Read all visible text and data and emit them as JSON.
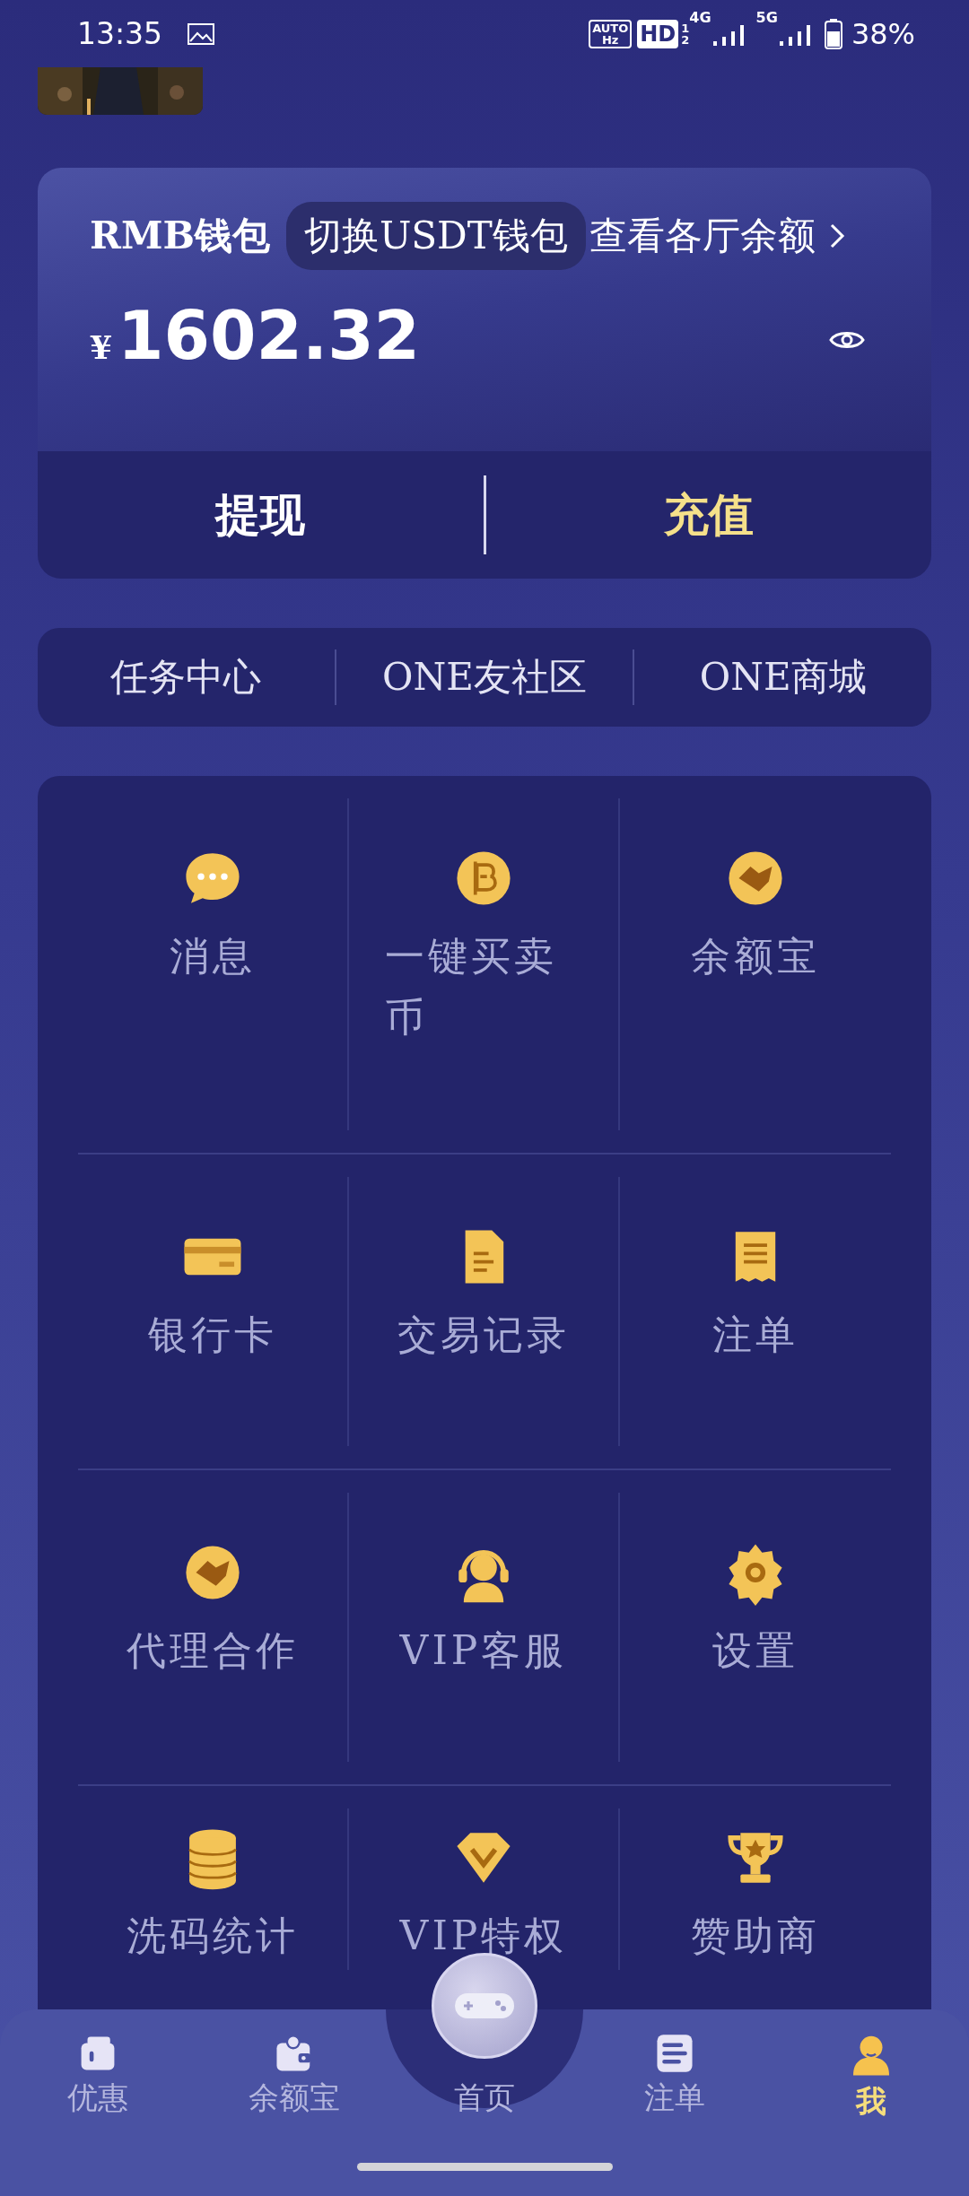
{
  "status_bar": {
    "time": "13:35",
    "auto": "AUTO",
    "hz": "Hz",
    "hd": "HD",
    "sim1": "1",
    "sim2": "2",
    "net1": "4G",
    "net2": "5G",
    "battery": "38%"
  },
  "wallet": {
    "title": "RMB钱包",
    "switch": "切换USDT钱包",
    "link": "查看各厅余额",
    "currency": "¥",
    "balance": "1602.32",
    "actions": [
      {
        "label": "提现",
        "kind": "plain"
      },
      {
        "label": "充值",
        "kind": "accent"
      }
    ]
  },
  "links": [
    "任务中心",
    "ONE友社区",
    "ONE商城"
  ],
  "menu": [
    "消息",
    "一键买卖币",
    "余额宝",
    "银行卡",
    "交易记录",
    "注单",
    "代理合作",
    "VIP客服",
    "设置",
    "洗码统计",
    "VIP特权",
    "赞助商"
  ],
  "nav": [
    {
      "label": "优惠",
      "selected": false
    },
    {
      "label": "余额宝",
      "selected": false
    },
    {
      "label": "首页",
      "selected": false
    },
    {
      "label": "注单",
      "selected": false
    },
    {
      "label": "我",
      "selected": true
    }
  ]
}
